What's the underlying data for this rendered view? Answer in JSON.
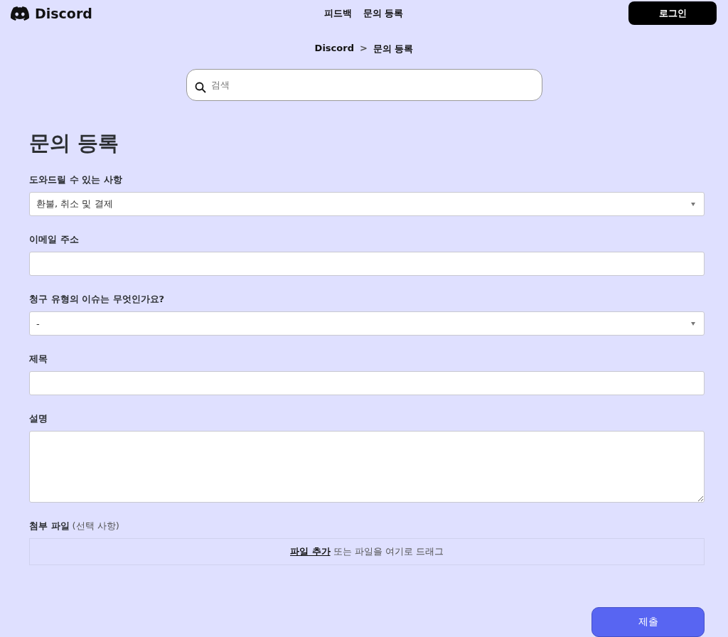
{
  "header": {
    "brand": "Discord",
    "nav": [
      "피드백",
      "문의 등록"
    ],
    "login": "로그인"
  },
  "breadcrumb": {
    "items": [
      "Discord",
      "문의 등록"
    ],
    "separator": ">"
  },
  "search": {
    "placeholder": "검색"
  },
  "title": "문의 등록",
  "fields": [
    {
      "kind": "select",
      "label": "도와드릴 수 있는 사항",
      "value": "환불, 취소 및 결제"
    },
    {
      "kind": "input",
      "label": "이메일 주소"
    },
    {
      "kind": "select",
      "label": "청구 유형의 이슈는 무엇인가요?",
      "value": "-"
    },
    {
      "kind": "input",
      "label": "제목"
    },
    {
      "kind": "textarea",
      "label": "설명"
    }
  ],
  "attachment": {
    "label": "첨부 파일",
    "note": "(선택 사항)",
    "link": "파일 추가",
    "text": "또는 파일을 여기로 드래그"
  },
  "submit": "제출"
}
